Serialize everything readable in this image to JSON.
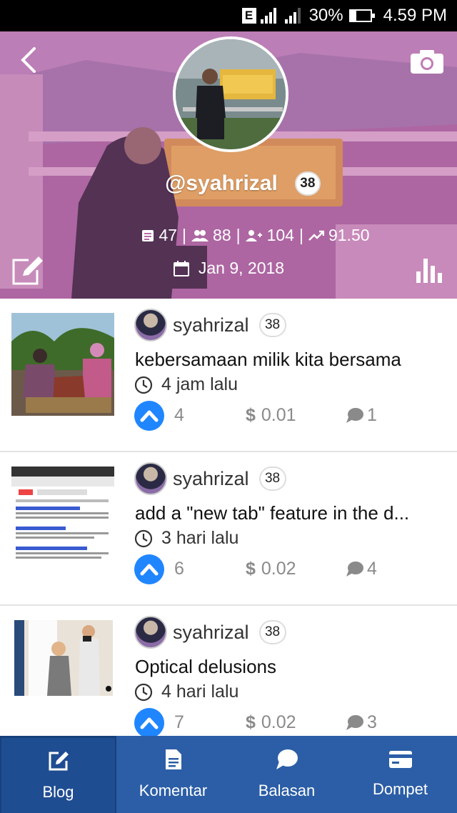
{
  "status_bar": {
    "network_badge": "E",
    "battery_text": "30%",
    "time": "4.59 PM"
  },
  "profile": {
    "username": "@syahrizal",
    "reputation": "38",
    "stats": {
      "posts": "47",
      "followers": "88",
      "following": "104",
      "power": "91.50"
    },
    "joined_date": "Jan 9, 2018",
    "icons": [
      "back-arrow-icon",
      "camera-icon",
      "edit-icon",
      "bar-chart-icon"
    ]
  },
  "posts": [
    {
      "author": "syahrizal",
      "author_rep": "38",
      "title": "kebersamaan milik kita bersama",
      "time": "4 jam lalu",
      "votes": "4",
      "payout": "0.01",
      "comments": "1"
    },
    {
      "author": "syahrizal",
      "author_rep": "38",
      "title": "add a \"new tab\" feature in the d...",
      "time": "3 hari lalu",
      "votes": "6",
      "payout": "0.02",
      "comments": "4"
    },
    {
      "author": "syahrizal",
      "author_rep": "38",
      "title": "Optical delusions",
      "time": "4 hari lalu",
      "votes": "7",
      "payout": "0.02",
      "comments": "3"
    }
  ],
  "currency_symbol": "$",
  "bottom_nav": {
    "items": [
      {
        "label": "Blog",
        "icon": "edit-icon",
        "active": true
      },
      {
        "label": "Komentar",
        "icon": "document-icon",
        "active": false
      },
      {
        "label": "Balasan",
        "icon": "chat-bubble-icon",
        "active": false
      },
      {
        "label": "Dompet",
        "icon": "wallet-card-icon",
        "active": false
      }
    ]
  },
  "colors": {
    "header_tint": "#b96aa5",
    "upvote_blue": "#1f86ff",
    "nav_blue": "#2b5ea6",
    "nav_active": "#1f4d92"
  }
}
